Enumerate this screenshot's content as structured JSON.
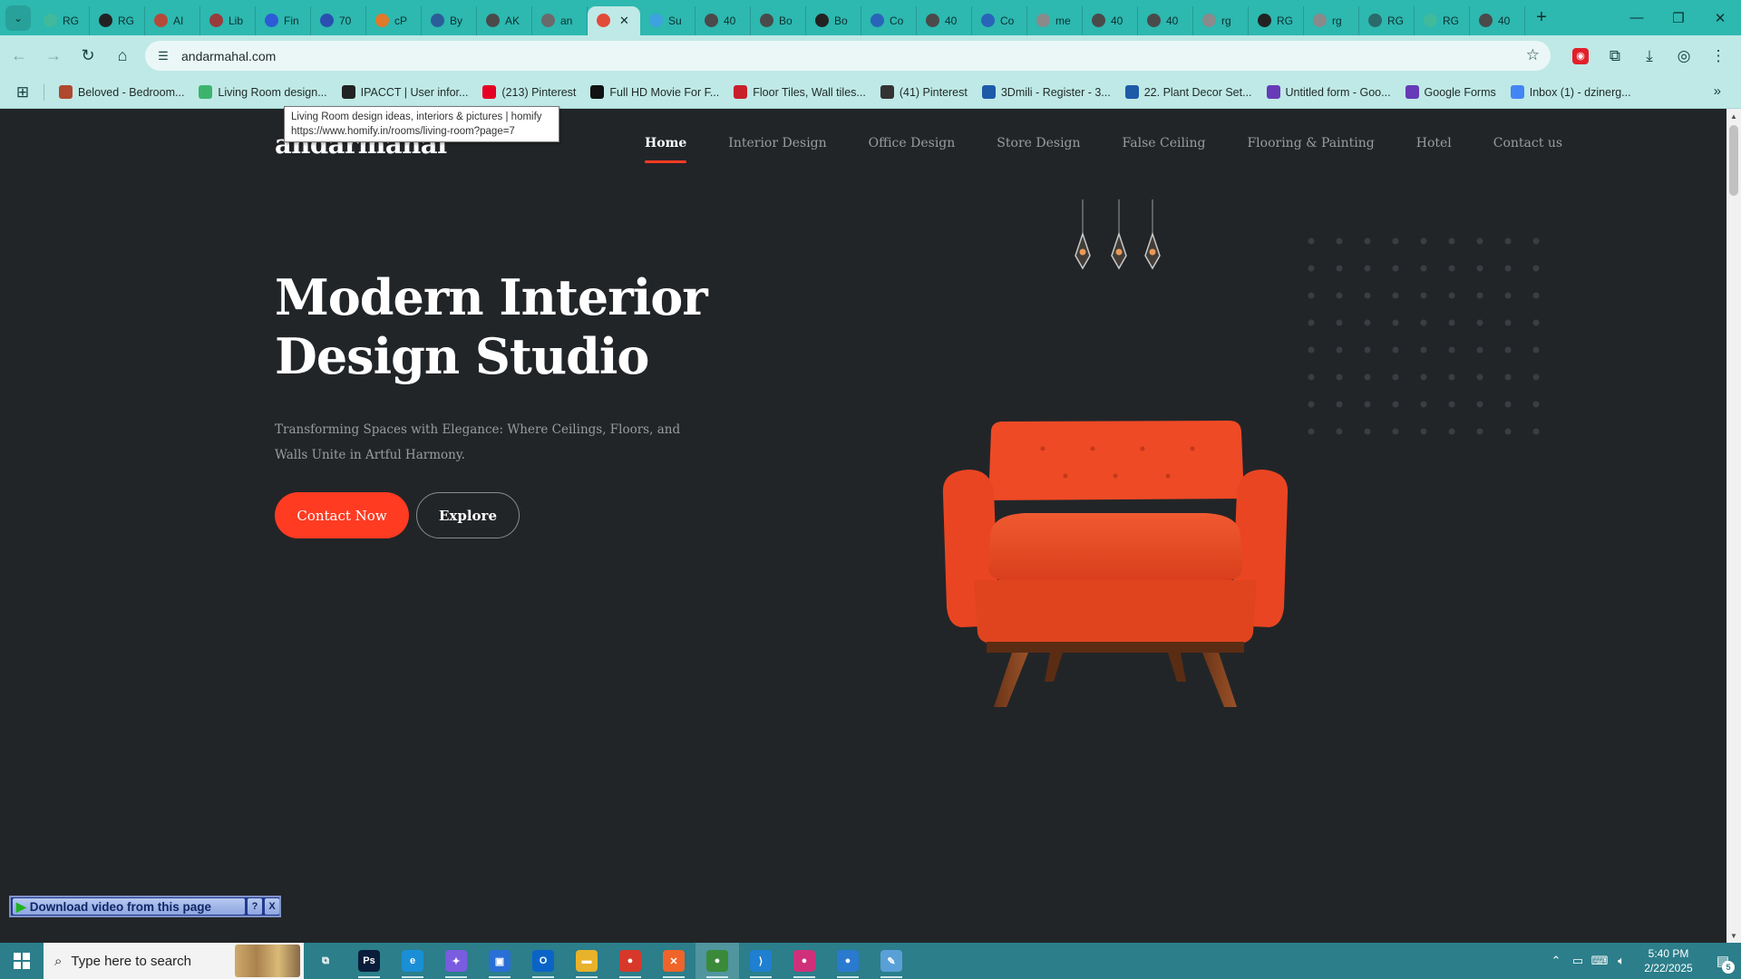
{
  "browser": {
    "tabs": [
      {
        "label": "RG",
        "icon": "researchgate-icon",
        "color": "#40ba9b"
      },
      {
        "label": "RG",
        "icon": "target-icon",
        "color": "#222222"
      },
      {
        "label": "AI",
        "icon": "ai-icon",
        "color": "#b44a3a"
      },
      {
        "label": "Lib",
        "icon": "library-icon",
        "color": "#9a3b3b"
      },
      {
        "label": "Fin",
        "icon": "flag-icon",
        "color": "#2d5bd6"
      },
      {
        "label": "70",
        "icon": "terminal-icon",
        "color": "#2a4fb0"
      },
      {
        "label": "cP",
        "icon": "cpanel-icon",
        "color": "#e07a2a"
      },
      {
        "label": "By",
        "icon": "by-icon",
        "color": "#2b5d9a"
      },
      {
        "label": "AK",
        "icon": "globe-icon",
        "color": "#4a4a4a"
      },
      {
        "label": "an",
        "icon": "globe-icon",
        "color": "#6a6a6a"
      },
      {
        "label": "",
        "icon": "andarmahal-icon",
        "color": "#e24a3a",
        "active": true
      },
      {
        "label": "Su",
        "icon": "bird-icon",
        "color": "#3ea2e0"
      },
      {
        "label": "40",
        "icon": "globe-icon",
        "color": "#4a4a4a"
      },
      {
        "label": "Bo",
        "icon": "globe-icon",
        "color": "#4a4a4a"
      },
      {
        "label": "Bo",
        "icon": "k-icon",
        "color": "#222222"
      },
      {
        "label": "Co",
        "icon": "feather-icon",
        "color": "#2a64b8"
      },
      {
        "label": "40",
        "icon": "globe-icon",
        "color": "#4a4a4a"
      },
      {
        "label": "Co",
        "icon": "feather-icon",
        "color": "#2a64b8"
      },
      {
        "label": "me",
        "icon": "globe-icon",
        "color": "#8a8a8a"
      },
      {
        "label": "40",
        "icon": "globe-icon",
        "color": "#4a4a4a"
      },
      {
        "label": "40",
        "icon": "globe-icon",
        "color": "#4a4a4a"
      },
      {
        "label": "rg",
        "icon": "globe-icon",
        "color": "#8a8a8a"
      },
      {
        "label": "RG",
        "icon": "k-icon",
        "color": "#222222"
      },
      {
        "label": "rg",
        "icon": "globe-icon",
        "color": "#8a8a8a"
      },
      {
        "label": "RG",
        "icon": "researchgate-icon",
        "color": "#2a6a6a"
      },
      {
        "label": "RG",
        "icon": "researchgate-icon",
        "color": "#40ba9b"
      },
      {
        "label": "40",
        "icon": "globe-icon",
        "color": "#4a4a4a"
      }
    ],
    "url": "andarmahal.com",
    "bookmarks": [
      {
        "label": "Beloved - Bedroom...",
        "icon": "beloved-icon",
        "color": "#b0472f"
      },
      {
        "label": "Living Room design...",
        "icon": "homify-icon",
        "color": "#3db46d"
      },
      {
        "label": "IPACCT | User infor...",
        "icon": "ip-icon",
        "color": "#222222"
      },
      {
        "label": "(213) Pinterest",
        "icon": "pinterest-icon",
        "color": "#e60023"
      },
      {
        "label": "Full HD Movie For F...",
        "icon": "play-icon",
        "color": "#111111"
      },
      {
        "label": "Floor Tiles, Wall tiles...",
        "icon": "tiles-icon",
        "color": "#c8202a"
      },
      {
        "label": "(41) Pinterest",
        "icon": "globe-icon",
        "color": "#333333"
      },
      {
        "label": "3Dmili - Register - 3...",
        "icon": "m-icon",
        "color": "#1d5aa8"
      },
      {
        "label": "22. Plant Decor Set...",
        "icon": "m-icon",
        "color": "#1d5aa8"
      },
      {
        "label": "Untitled form - Goo...",
        "icon": "forms-icon",
        "color": "#673ab7"
      },
      {
        "label": "Google Forms",
        "icon": "forms-icon",
        "color": "#673ab7"
      },
      {
        "label": "Inbox (1) - dzinerg...",
        "icon": "google-icon",
        "color": "#4285f4"
      }
    ],
    "tooltip": {
      "title": "Living Room design ideas, interiors & pictures | homify",
      "url": "https://www.homify.in/rooms/living-room?page=7"
    }
  },
  "site": {
    "logo": "andarmahal",
    "nav": [
      {
        "label": "Home",
        "active": true
      },
      {
        "label": "Interior Design"
      },
      {
        "label": "Office Design"
      },
      {
        "label": "Store Design"
      },
      {
        "label": "False Ceiling"
      },
      {
        "label": "Flooring & Painting"
      },
      {
        "label": "Hotel"
      },
      {
        "label": "Contact us"
      }
    ],
    "hero": {
      "title_line1": "Modern Interior",
      "title_line2": "Design Studio",
      "subtitle": "Transforming Spaces with Elegance: Where Ceilings, Floors, and Walls Unite in Artful Harmony.",
      "cta_primary": "Contact Now",
      "cta_secondary": "Explore"
    },
    "colors": {
      "accent": "#ff3b22",
      "background": "#222528",
      "chair": "#ee4a26"
    }
  },
  "download_bar": {
    "label": "Download video from this page",
    "help": "?",
    "close": "X"
  },
  "taskbar": {
    "search_placeholder": "Type here to search",
    "apps": [
      {
        "name": "task-view-icon",
        "color": "transparent",
        "glyph": "⧉"
      },
      {
        "name": "photoshop-icon",
        "color": "#0a1d3a",
        "glyph": "Ps"
      },
      {
        "name": "edge-icon",
        "color": "#1b8fd6",
        "glyph": "e"
      },
      {
        "name": "copilot-icon",
        "color": "#7a5ce0",
        "glyph": "✦"
      },
      {
        "name": "store-icon",
        "color": "#2a6fd6",
        "glyph": "▣"
      },
      {
        "name": "outlook-icon",
        "color": "#0a64c8",
        "glyph": "O"
      },
      {
        "name": "file-explorer-icon",
        "color": "#e8b22a",
        "glyph": "▬"
      },
      {
        "name": "chrome-icon",
        "color": "#d8382a",
        "glyph": "●"
      },
      {
        "name": "xampp-icon",
        "color": "#f0642a",
        "glyph": "✕"
      },
      {
        "name": "chrome-profile-icon",
        "color": "#3a8a3a",
        "glyph": "●",
        "active": true
      },
      {
        "name": "vscode-icon",
        "color": "#1f7fd0",
        "glyph": "⟩"
      },
      {
        "name": "chrome-profile-2-icon",
        "color": "#d0307a",
        "glyph": "●"
      },
      {
        "name": "chrome-profile-3-icon",
        "color": "#2a7ad0",
        "glyph": "●"
      },
      {
        "name": "paint-icon",
        "color": "#5aa0d8",
        "glyph": "✎"
      }
    ],
    "time": "5:40 PM",
    "date": "2/22/2025",
    "notifications": "5"
  }
}
